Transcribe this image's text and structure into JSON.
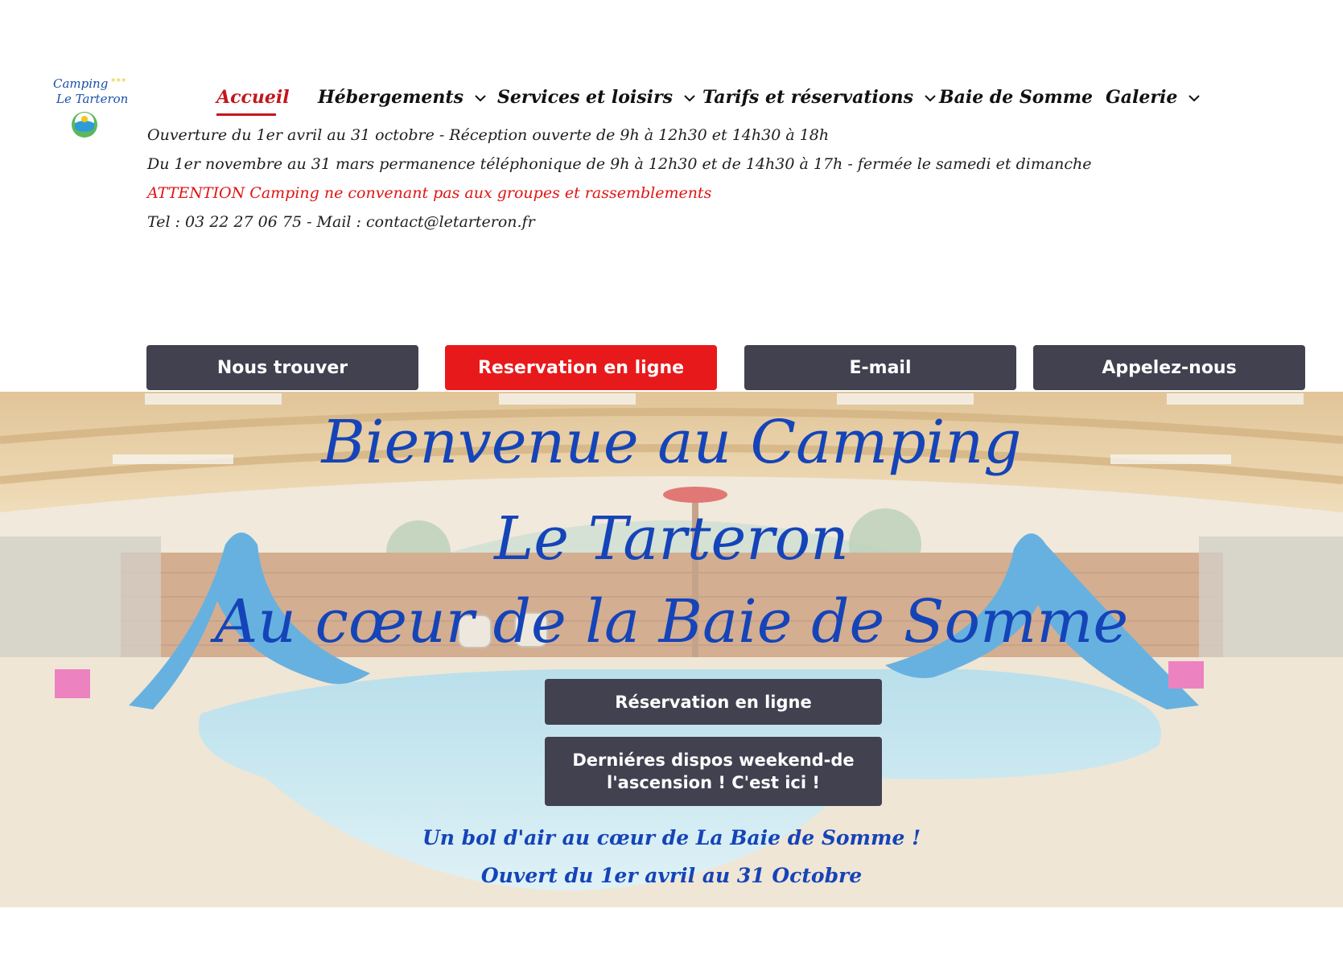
{
  "logo": {
    "line1": "Camping",
    "line2": "Le Tarteron",
    "stars": "***"
  },
  "nav": {
    "items": [
      {
        "label": "Accueil",
        "active": true,
        "dropdown": false
      },
      {
        "label": "Hébergements",
        "dropdown": true
      },
      {
        "label": "Services et loisirs",
        "dropdown": true
      },
      {
        "label": "Tarifs et réservations",
        "dropdown": true
      },
      {
        "label": "Baie de Somme",
        "dropdown": false
      },
      {
        "label": "Galerie",
        "dropdown": true
      }
    ]
  },
  "info": {
    "line1": "Ouverture du 1er avril au 31 octobre - Réception ouverte de 9h à 12h30 et 14h30 à 18h",
    "line2": "Du 1er novembre au 31 mars permanence téléphonique de 9h à 12h30 et de 14h30 à 17h - fermée le samedi et dimanche",
    "line3": "ATTENTION Camping ne convenant pas aux groupes et rassemblements",
    "line4": "Tel : 03 22 27 06 75  -  Mail : contact@letarteron.fr"
  },
  "action_buttons": {
    "find": "Nous trouver",
    "book": "Reservation en ligne",
    "email": "E-mail",
    "call": "Appelez-nous"
  },
  "hero": {
    "title1": "Bienvenue au Camping",
    "title2": "Le Tarteron",
    "title3": "Au cœur de la Baie de Somme",
    "btn_book": "Réservation en ligne",
    "btn_dispos_l1": "Derniéres dispos weekend-de",
    "btn_dispos_l2": "l'ascension ! C'est ici !",
    "tagline1": "Un bol d'air au cœur de La Baie de Somme !",
    "tagline2": "Ouvert du 1er avril au 31 Octobre"
  },
  "colors": {
    "accent_red": "#e8191b",
    "nav_active": "#c4161c",
    "button_dark": "#424150",
    "hero_text": "#1544b8"
  }
}
